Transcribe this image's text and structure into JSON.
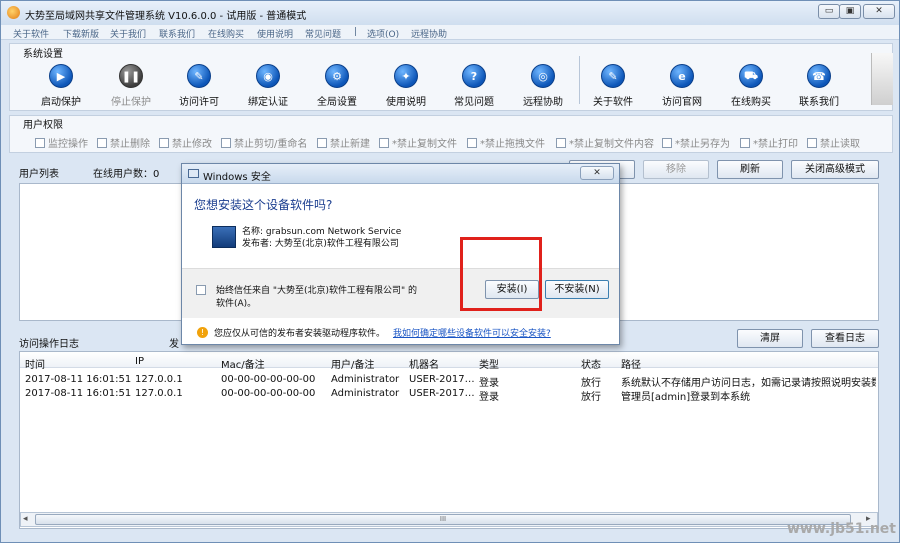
{
  "window": {
    "title": "大势至局域网共享文件管理系统 V10.6.0.0 - 试用版 - 普通模式",
    "min": "▭",
    "max": "▣",
    "close": "✕"
  },
  "menu": [
    "关于软件",
    "下载新版",
    "关于我们",
    "联系我们",
    "在线购买",
    "使用说明",
    "常见问题",
    "|",
    "选项(O)",
    "远程协助"
  ],
  "system_settings": {
    "label": "系统设置",
    "tools": [
      {
        "label": "启动保护",
        "icon": "▶"
      },
      {
        "label": "停止保护",
        "icon": "❚❚"
      },
      {
        "label": "访问许可",
        "icon": "✎"
      },
      {
        "label": "绑定认证",
        "icon": "◉"
      },
      {
        "label": "全局设置",
        "icon": "⚙"
      },
      {
        "label": "使用说明",
        "icon": "✦"
      },
      {
        "label": "常见问题",
        "icon": "?"
      },
      {
        "label": "远程协助",
        "icon": "◎"
      },
      {
        "label": "关于软件",
        "icon": "✎"
      },
      {
        "label": "访问官网",
        "icon": "e"
      },
      {
        "label": "在线购买",
        "icon": "⛟"
      },
      {
        "label": "联系我们",
        "icon": "☎"
      }
    ]
  },
  "user_permissions": {
    "label": "用户权限",
    "items": [
      "监控操作",
      "禁止删除",
      "禁止修改",
      "禁止剪切/重命名",
      "禁止新建",
      "*禁止复制文件",
      "*禁止拖拽文件",
      "*禁止复制文件内容",
      "*禁止另存为",
      "*禁止打印",
      "禁止读取"
    ]
  },
  "user_list": {
    "label": "用户列表",
    "online_count": "在线用户数：0",
    "buttons": {
      "remove": "移除",
      "refresh": "刷新",
      "close_adv": "关闭高级模式"
    }
  },
  "access_log": {
    "label": "访问操作日志",
    "partial": "发",
    "buttons": {
      "clear": "清屏",
      "view": "查看日志"
    },
    "columns": [
      "时间",
      "IP",
      "Mac/备注",
      "用户/备注",
      "机器名",
      "类型",
      "状态",
      "路径"
    ],
    "rows": [
      [
        "2017-08-11 16:01:51",
        "127.0.0.1",
        "00-00-00-00-00-00",
        "Administrator",
        "USER-2017…",
        "登录",
        "放行",
        "系统默认不存储用户访问日志，如需记录请按照说明安装数据库"
      ],
      [
        "2017-08-11 16:01:51",
        "127.0.0.1",
        "00-00-00-00-00-00",
        "Administrator",
        "USER-2017…",
        "登录",
        "放行",
        "管理员[admin]登录到本系统"
      ]
    ]
  },
  "dialog": {
    "title": "Windows 安全",
    "heading": "您想安装这个设备软件吗?",
    "name_line": "名称: grabsun.com Network Service",
    "publisher_line": "发布者: 大势至(北京)软件工程有限公司",
    "trust_line1": "始终信任来自 \"大势至(北京)软件工程有限公司\" 的",
    "trust_line2": "软件(A)。",
    "install": "安装(I)",
    "dont_install": "不安装(N)",
    "footer_text": "您应仅从可信的发布者安装驱动程序软件。",
    "footer_link": "我如何确定哪些设备软件可以安全安装?"
  },
  "scrollbar": {
    "mid": "III"
  },
  "watermark": "www.jb51.net"
}
